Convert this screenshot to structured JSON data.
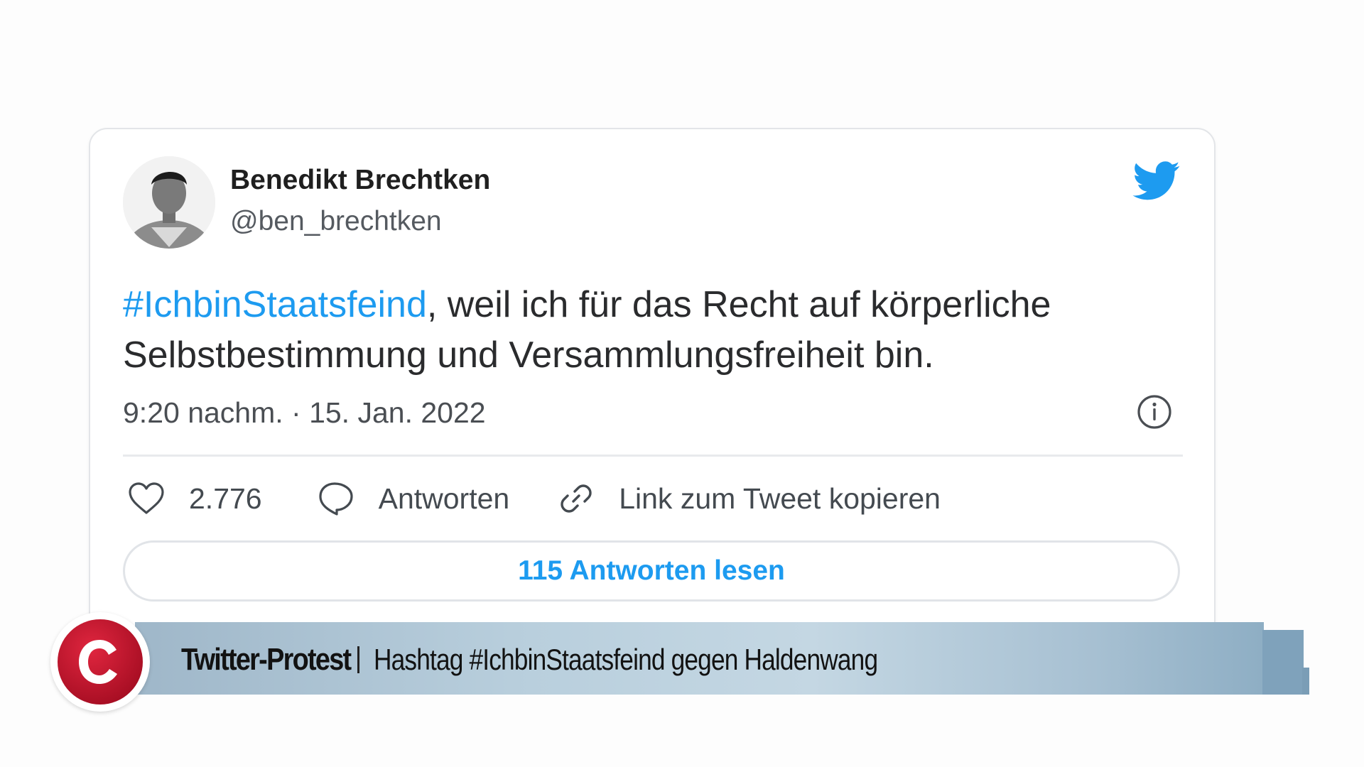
{
  "tweet": {
    "author_name": "Benedikt Brechtken",
    "author_handle": "@ben_brechtken",
    "hashtag": "#IchbinStaatsfeind",
    "text_rest": ", weil ich für das Recht auf körperliche Selbstbestimmung und Versammlungsfreiheit bin.",
    "timestamp": "9:20 nachm. · 15. Jan. 2022",
    "likes": "2.776",
    "reply_label": "Antworten",
    "copy_link_label": "Link zum Tweet kopieren",
    "read_replies_label": "115 Antworten lesen",
    "accent_color": "#1d9bf0"
  },
  "icons": {
    "brand": "twitter-bird-icon",
    "info": "info-icon",
    "like": "heart-icon",
    "reply": "speech-bubble-icon",
    "link": "link-icon"
  },
  "lower_third": {
    "title": "Twitter-Protest",
    "subtitle": "Hashtag #IchbinStaatsfeind gegen Haldenwang",
    "logo_letter": "C",
    "logo_color": "#c8102e"
  }
}
